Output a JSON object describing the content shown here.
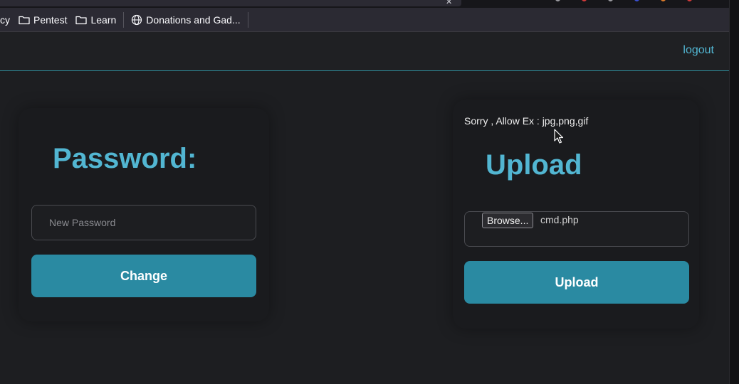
{
  "browser": {
    "bookmarks": [
      {
        "label": "cy",
        "icon": "none"
      },
      {
        "label": "Pentest",
        "icon": "folder-icon"
      },
      {
        "label": "Learn",
        "icon": "folder-icon"
      },
      {
        "label": "Donations and Gad...",
        "icon": "globe-icon"
      }
    ]
  },
  "navbar": {
    "logout_label": "logout"
  },
  "password_card": {
    "title": "Password:",
    "input_placeholder": "New Password",
    "input_value": "",
    "button_label": "Change"
  },
  "upload_card": {
    "notice": "Sorry , Allow Ex : jpg,png,gif",
    "title": "Upload",
    "browse_label": "Browse...",
    "selected_file": "cmd.php",
    "button_label": "Upload"
  },
  "colors": {
    "accent": "#52b6d2",
    "button": "#2a8aa2",
    "background": "#1d1e21",
    "card": "#1a1b1e"
  }
}
